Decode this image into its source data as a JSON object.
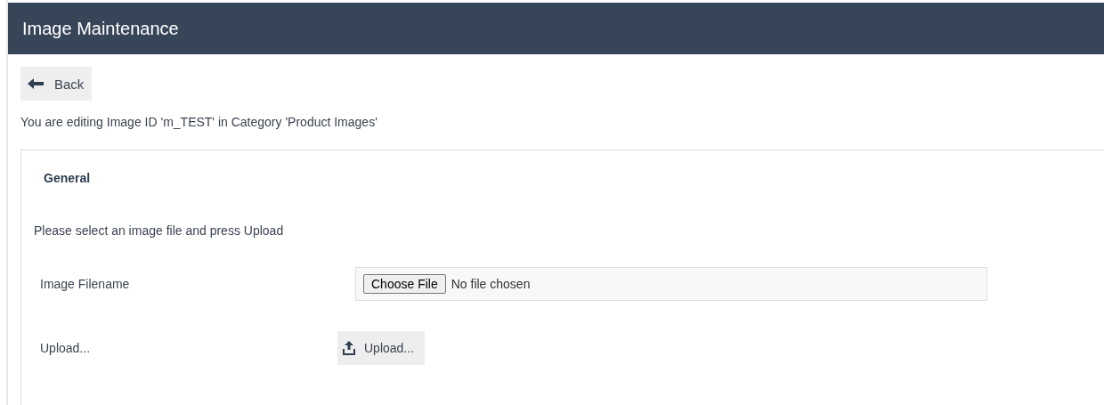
{
  "header": {
    "title": "Image Maintenance"
  },
  "back_button": {
    "label": "Back"
  },
  "context_text": "You are editing Image ID 'm_TEST' in Category 'Product Images'",
  "panel": {
    "title": "General",
    "instruction": "Please select an image file and press Upload",
    "fields": [
      {
        "kind": "file",
        "label": "Image Filename",
        "button": "Choose File",
        "status": "No file chosen"
      },
      {
        "kind": "upload",
        "label": "Upload...",
        "button": "Upload..."
      }
    ]
  }
}
